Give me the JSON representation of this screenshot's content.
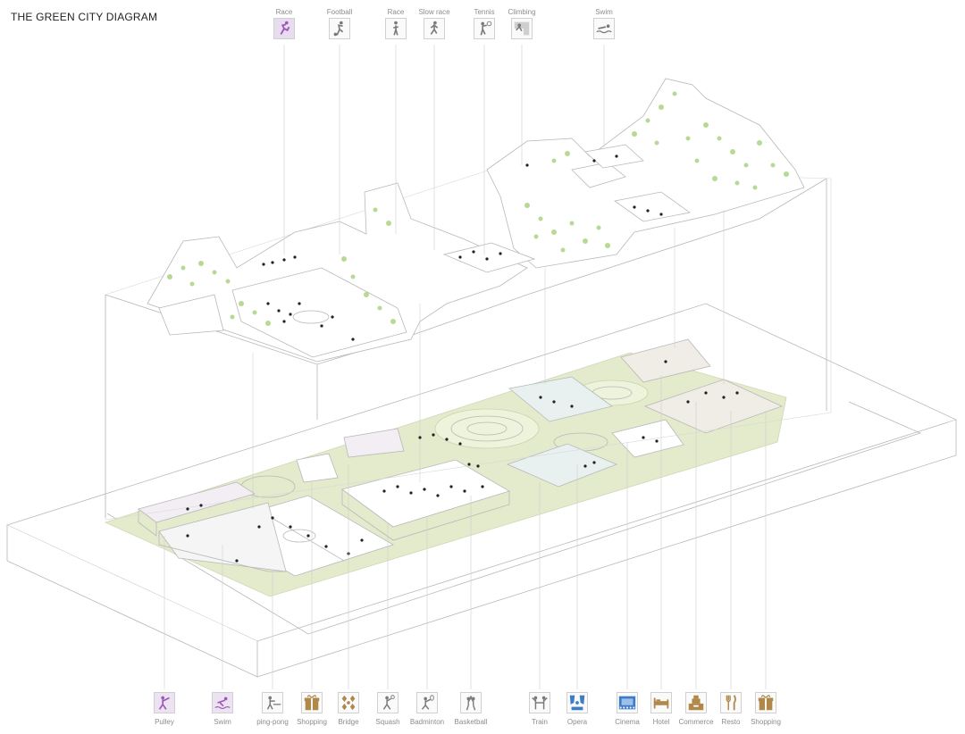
{
  "title": "THE GREEN CITY DIAGRAM",
  "colors": {
    "sport_purple": "#9b59b6",
    "sport_gray": "#7a7a7a",
    "culture_blue": "#3d7cc9",
    "commerce_brown": "#b0894a",
    "vegetation_green": "#9ccc65",
    "ground_green": "#dfe8c7",
    "outline_gray": "#b5b5b5"
  },
  "top_icons": [
    {
      "label": "Race",
      "icon": "runner-icon",
      "color": "purple"
    },
    {
      "label": "Football",
      "icon": "football-player-icon",
      "color": "gray"
    },
    {
      "label": "Race",
      "icon": "walker-icon",
      "color": "gray"
    },
    {
      "label": "Slow race",
      "icon": "jogger-icon",
      "color": "gray"
    },
    {
      "label": "Tennis",
      "icon": "tennis-player-icon",
      "color": "gray"
    },
    {
      "label": "Climbing",
      "icon": "climber-icon",
      "color": "gray"
    },
    {
      "label": "Swim",
      "icon": "swimmer-icon",
      "color": "gray"
    }
  ],
  "bottom_icons": [
    {
      "label": "Pulley",
      "icon": "pulley-icon",
      "color": "purple"
    },
    {
      "label": "Swim",
      "icon": "swimmer-icon",
      "color": "purple"
    },
    {
      "label": "ping-pong",
      "icon": "ping-pong-icon",
      "color": "gray"
    },
    {
      "label": "Shopping",
      "icon": "gift-box-icon",
      "color": "brown"
    },
    {
      "label": "Bridge",
      "icon": "bridge-cards-icon",
      "color": "brown"
    },
    {
      "label": "Squash",
      "icon": "squash-icon",
      "color": "gray"
    },
    {
      "label": "Badminton",
      "icon": "badminton-icon",
      "color": "gray"
    },
    {
      "label": "Basketball",
      "icon": "basketball-icon",
      "color": "gray"
    },
    {
      "label": "Train",
      "icon": "train-figures-icon",
      "color": "gray"
    },
    {
      "label": "Opera",
      "icon": "opera-icon",
      "color": "blue"
    },
    {
      "label": "Cinema",
      "icon": "cinema-icon",
      "color": "blue"
    },
    {
      "label": "Hotel",
      "icon": "bed-icon",
      "color": "brown"
    },
    {
      "label": "Commerce",
      "icon": "cash-register-icon",
      "color": "brown"
    },
    {
      "label": "Resto",
      "icon": "fork-knife-icon",
      "color": "brown"
    },
    {
      "label": "Shopping",
      "icon": "gift-box-icon",
      "color": "brown"
    }
  ]
}
